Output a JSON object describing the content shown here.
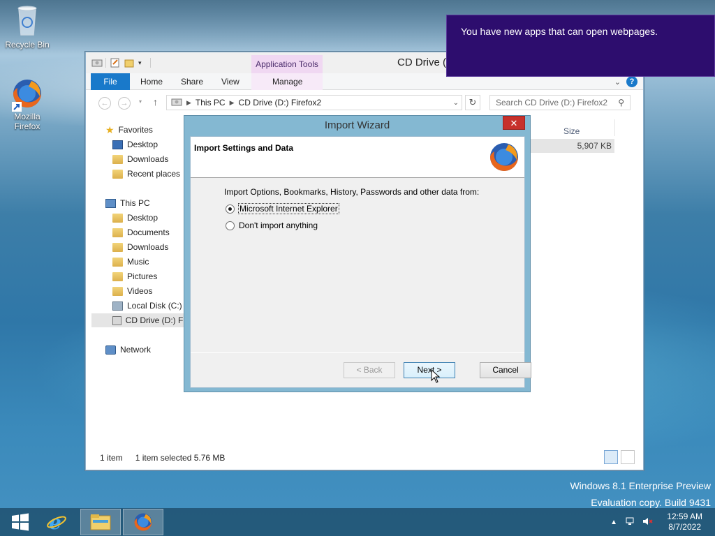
{
  "desktop": {
    "recycle_bin_label": "Recycle Bin",
    "firefox_label_line1": "Mozilla",
    "firefox_label_line2": "Firefox"
  },
  "explorer": {
    "title": "CD Drive (D:",
    "context_tab_group": "Application Tools",
    "tabs": [
      "File",
      "Home",
      "Share",
      "View",
      "Manage"
    ],
    "address": {
      "segment1": "This PC",
      "segment2": "CD Drive (D:) Firefox2"
    },
    "search_placeholder": "Search CD Drive (D:) Firefox2",
    "nav": {
      "favorites": "Favorites",
      "fav_desktop": "Desktop",
      "fav_downloads": "Downloads",
      "fav_recent": "Recent places",
      "this_pc": "This PC",
      "pc_desktop": "Desktop",
      "pc_documents": "Documents",
      "pc_downloads": "Downloads",
      "pc_music": "Music",
      "pc_pictures": "Pictures",
      "pc_videos": "Videos",
      "pc_local_disk": "Local Disk (C:)",
      "pc_cd_drive": "CD Drive (D:) Fi",
      "network": "Network"
    },
    "column_size": "Size",
    "file_size": "5,907 KB",
    "status_count": "1 item",
    "status_selected": "1 item selected  5.76 MB"
  },
  "wizard": {
    "title": "Import Wizard",
    "close_glyph": "✕",
    "header": "Import Settings and Data",
    "prompt": "Import Options, Bookmarks, History, Passwords and other data from:",
    "option_ie": "Microsoft Internet Explorer",
    "option_none": "Don't import anything",
    "back_label": "< Back",
    "next_label": "Next >",
    "cancel_label": "Cancel"
  },
  "toast": {
    "message": "You have new apps that can open webpages."
  },
  "watermark": {
    "line1": "Windows 8.1 Enterprise Preview",
    "line2": "Evaluation copy. Build 9431"
  },
  "taskbar": {
    "time": "12:59 AM",
    "date": "8/7/2022"
  }
}
